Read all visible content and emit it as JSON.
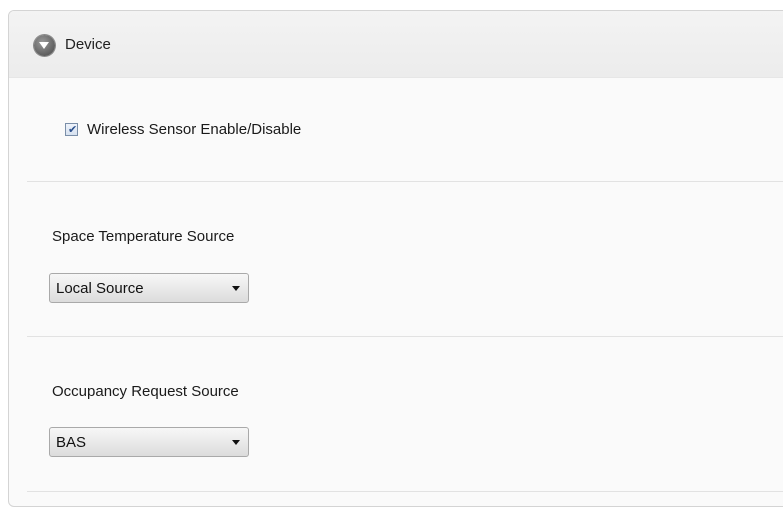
{
  "panel": {
    "title": "Device"
  },
  "wireless": {
    "label": "Wireless Sensor Enable/Disable",
    "checked": true
  },
  "space_temperature": {
    "label": "Space Temperature Source",
    "selected": "Local Source"
  },
  "occupancy_request": {
    "label": "Occupancy Request Source",
    "selected": "BAS"
  },
  "icons": {
    "collapse": "chevron-down-circle-icon",
    "check": "check-icon",
    "dropdown_arrow": "caret-down-icon"
  }
}
